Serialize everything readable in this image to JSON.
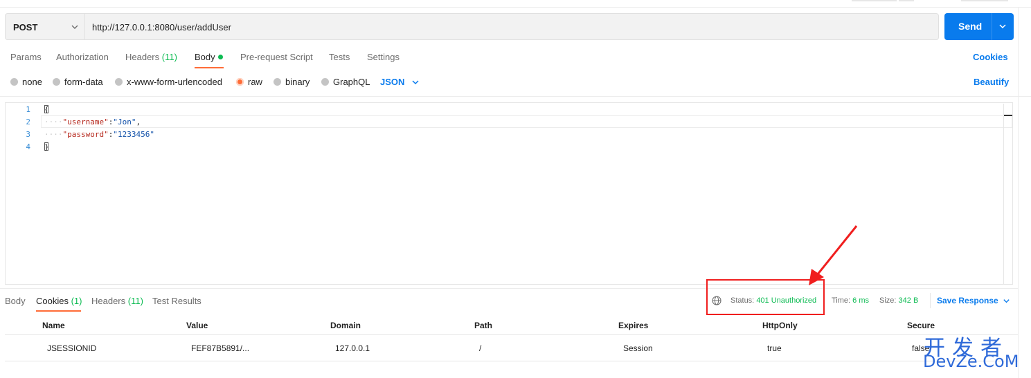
{
  "request": {
    "method": "POST",
    "url": "http://127.0.0.1:8080/user/addUser",
    "send_label": "Send"
  },
  "tabs": [
    {
      "label": "Params"
    },
    {
      "label": "Authorization"
    },
    {
      "label": "Headers",
      "count": "(11)"
    },
    {
      "label": "Body",
      "active": true
    },
    {
      "label": "Pre-request Script"
    },
    {
      "label": "Tests"
    },
    {
      "label": "Settings"
    }
  ],
  "cookies_link": "Cookies",
  "body_types": {
    "options": [
      "none",
      "form-data",
      "x-www-form-urlencoded",
      "raw",
      "binary",
      "GraphQL"
    ],
    "selected": "raw",
    "format": "JSON",
    "beautify_label": "Beautify"
  },
  "editor": {
    "line_numbers": [
      "1",
      "2",
      "3",
      "4"
    ],
    "lines": {
      "l1": "{",
      "l2_key": "\"username\"",
      "l2_colon": ":",
      "l2_value": "\"Jon\"",
      "l2_comma": ",",
      "l3_key": "\"password\"",
      "l3_colon": ":",
      "l3_value": "\"1233456\"",
      "l4": "}"
    }
  },
  "response": {
    "tabs": [
      {
        "label": "Body"
      },
      {
        "label": "Cookies",
        "count": "(1)",
        "active": true
      },
      {
        "label": "Headers",
        "count": "(11)"
      },
      {
        "label": "Test Results"
      }
    ],
    "status_label": "Status:",
    "status_value": "401 Unauthorized",
    "time_label": "Time:",
    "time_value": "6 ms",
    "size_label": "Size:",
    "size_value": "342 B",
    "save_label": "Save Response",
    "cookie_columns": [
      "Name",
      "Value",
      "Domain",
      "Path",
      "Expires",
      "HttpOnly",
      "Secure"
    ],
    "cookie_rows": [
      {
        "name": "JSESSIONID",
        "value": "FEF87B5891/...",
        "domain": "127.0.0.1",
        "path": "/",
        "expires": "Session",
        "httponly": "true",
        "secure": "false"
      }
    ]
  },
  "watermark": {
    "line1": "开发者",
    "line2": "DevZe.CoM"
  },
  "colors": {
    "accent_orange": "#ff6c37",
    "send_blue": "#097bed",
    "count_green": "#0cbb52",
    "annotation_red": "#f01e1e"
  },
  "icons": [
    "chevron-down-icon",
    "globe-icon",
    "arrow-annotation"
  ]
}
